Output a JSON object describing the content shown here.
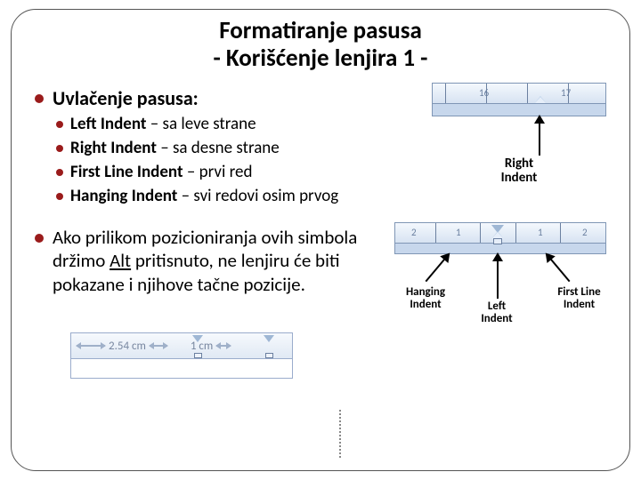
{
  "title_line1": "Formatiranje pasusa",
  "title_line2": "- Korišćenje lenjira 1 -",
  "section1": {
    "heading": "Uvlačenje pasusa:",
    "items": [
      {
        "term": "Left Indent",
        "def": " – sa leve strane"
      },
      {
        "term": "Right Indent",
        "def": " – sa desne strane"
      },
      {
        "term": "First Line Indent",
        "def": " – prvi red"
      },
      {
        "term": "Hanging Indent",
        "def": " – svi redovi osim prvog"
      }
    ]
  },
  "section2": {
    "text_pre": "Ako prilikom pozicioniranja ovih simbola držimo ",
    "alt_key": "Alt",
    "text_post": " pritisnuto, ne lenjiru će biti pokazane  i njihove tačne pozicije."
  },
  "fig_right": {
    "num_a": "16",
    "num_b": "17",
    "label_l1": "Right",
    "label_l2": "Indent"
  },
  "fig_three": {
    "num_a": "2",
    "num_b": "1",
    "num_c": "1",
    "num_d": "2",
    "hanging_l1": "Hanging",
    "hanging_l2": "Indent",
    "left_l1": "Left",
    "left_l2": "Indent",
    "first_l1": "First Line",
    "first_l2": "Indent"
  },
  "fig_cm": {
    "val1": "2.54 cm",
    "val2": "1 cm"
  }
}
